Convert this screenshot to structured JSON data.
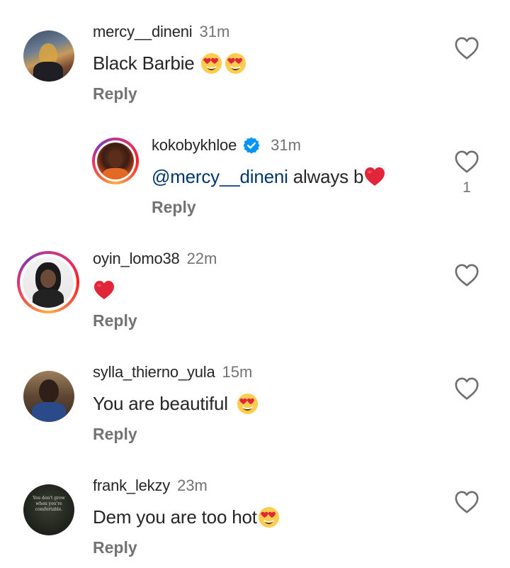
{
  "comments": [
    {
      "username": "mercy__dineni",
      "time": "31m",
      "text": "Black Barbie",
      "emoji": [
        "smiling-face-with-heart-eyes",
        "smiling-face-with-heart-eyes"
      ],
      "reply_label": "Reply",
      "like_count": ""
    },
    {
      "username": "kokobykhloe",
      "time": "31m",
      "mention": "@mercy__dineni",
      "text": "always b",
      "emoji": [
        "red-heart"
      ],
      "verified": true,
      "reply_label": "Reply",
      "like_count": "1"
    },
    {
      "username": "oyin_lomo38",
      "time": "22m",
      "text": "",
      "emoji": [
        "red-heart"
      ],
      "reply_label": "Reply",
      "like_count": ""
    },
    {
      "username": "sylla_thierno_yula",
      "time": "15m",
      "text": "You are beautiful",
      "emoji": [
        "smiling-face-with-heart-eyes"
      ],
      "reply_label": "Reply",
      "like_count": ""
    },
    {
      "username": "frank_lekzy",
      "time": "23m",
      "text": "Dem you are too hot",
      "emoji": [
        "smiling-face-with-heart-eyes"
      ],
      "reply_label": "Reply",
      "like_count": "",
      "avatar_text": "You don't grow when you're comfortable."
    }
  ],
  "colors": {
    "text": "#262626",
    "secondary": "#737373",
    "mention": "#00376b",
    "verified": "#0095f6",
    "heart_red": "#e2263a"
  },
  "icons": {
    "like": "heart-outline-icon",
    "verified": "verified-badge-icon"
  }
}
